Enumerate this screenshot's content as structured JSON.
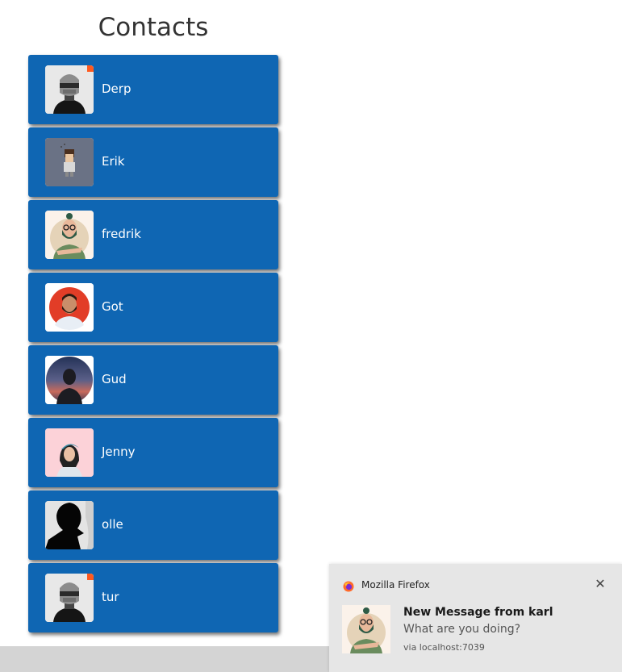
{
  "page": {
    "title": "Contacts"
  },
  "contacts": [
    {
      "name": "Derp",
      "avatar": "knight-helmet-avatar"
    },
    {
      "name": "Erik",
      "avatar": "pixel-girl-avatar"
    },
    {
      "name": "fredrik",
      "avatar": "bearded-man-bun-avatar"
    },
    {
      "name": "Got",
      "avatar": "bearded-man-red-avatar"
    },
    {
      "name": "Gud",
      "avatar": "silhouette-sunset-avatar"
    },
    {
      "name": "Jenny",
      "avatar": "woman-pink-avatar"
    },
    {
      "name": "olle",
      "avatar": "dark-silhouette-avatar"
    },
    {
      "name": "tur",
      "avatar": "knight-helmet-avatar"
    }
  ],
  "notification": {
    "app": "Mozilla Firefox",
    "title": "New Message from karl",
    "body": "What are you doing?",
    "source": "via localhost:7039",
    "close_icon": "close-icon",
    "app_icon": "firefox-icon",
    "image": "bearded-man-bun-avatar"
  },
  "colors": {
    "card": "#0f66b3",
    "card_text": "#ffffff",
    "title": "#333333",
    "toast_bg": "#e6e6e6",
    "bottom_bar": "#d4d4d4"
  }
}
